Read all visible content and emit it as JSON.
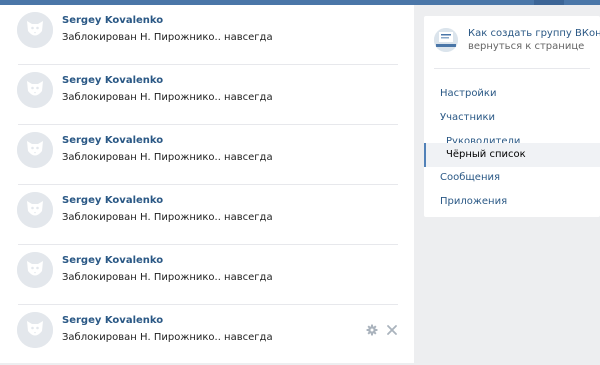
{
  "blacklist": {
    "rows": [
      {
        "name": "Sergey Kovalenko",
        "status": "Заблокирован Н. Пирожнико.. навсегда",
        "avatar_icon": "default-avatar-dog-icon"
      },
      {
        "name": "Sergey Kovalenko",
        "status": "Заблокирован Н. Пирожнико.. навсегда",
        "avatar_icon": "default-avatar-dog-icon"
      },
      {
        "name": "Sergey Kovalenko",
        "status": "Заблокирован Н. Пирожнико.. навсегда",
        "avatar_icon": "default-avatar-dog-icon"
      },
      {
        "name": "Sergey Kovalenko",
        "status": "Заблокирован Н. Пирожнико.. навсегда",
        "avatar_icon": "default-avatar-dog-icon"
      },
      {
        "name": "Sergey Kovalenko",
        "status": "Заблокирован Н. Пирожнико.. навсегда",
        "avatar_icon": "default-avatar-dog-icon"
      },
      {
        "name": "Sergey Kovalenko",
        "status": "Заблокирован Н. Пирожнико.. навсегда",
        "avatar_icon": "default-avatar-dog-icon"
      }
    ],
    "row_action_icons": [
      "gear-icon",
      "close-icon"
    ]
  },
  "sidebar": {
    "group_title": "Как создать группу ВКонтакте",
    "back_link": "вернуться к странице",
    "menu": [
      {
        "label": "Настройки",
        "level": 1,
        "active": false
      },
      {
        "label": "Участники",
        "level": 1,
        "active": false
      },
      {
        "label": "Руководители",
        "level": 2,
        "active": false
      },
      {
        "label": "Чёрный список",
        "level": 2,
        "active": true
      },
      {
        "label": "Сообщения",
        "level": 1,
        "active": false
      },
      {
        "label": "Приложения",
        "level": 1,
        "active": false
      }
    ]
  },
  "colors": {
    "link": "#2a5885",
    "header": "#4a76a8",
    "page_background": "#edeef0",
    "active_marker": "#5181b8"
  }
}
